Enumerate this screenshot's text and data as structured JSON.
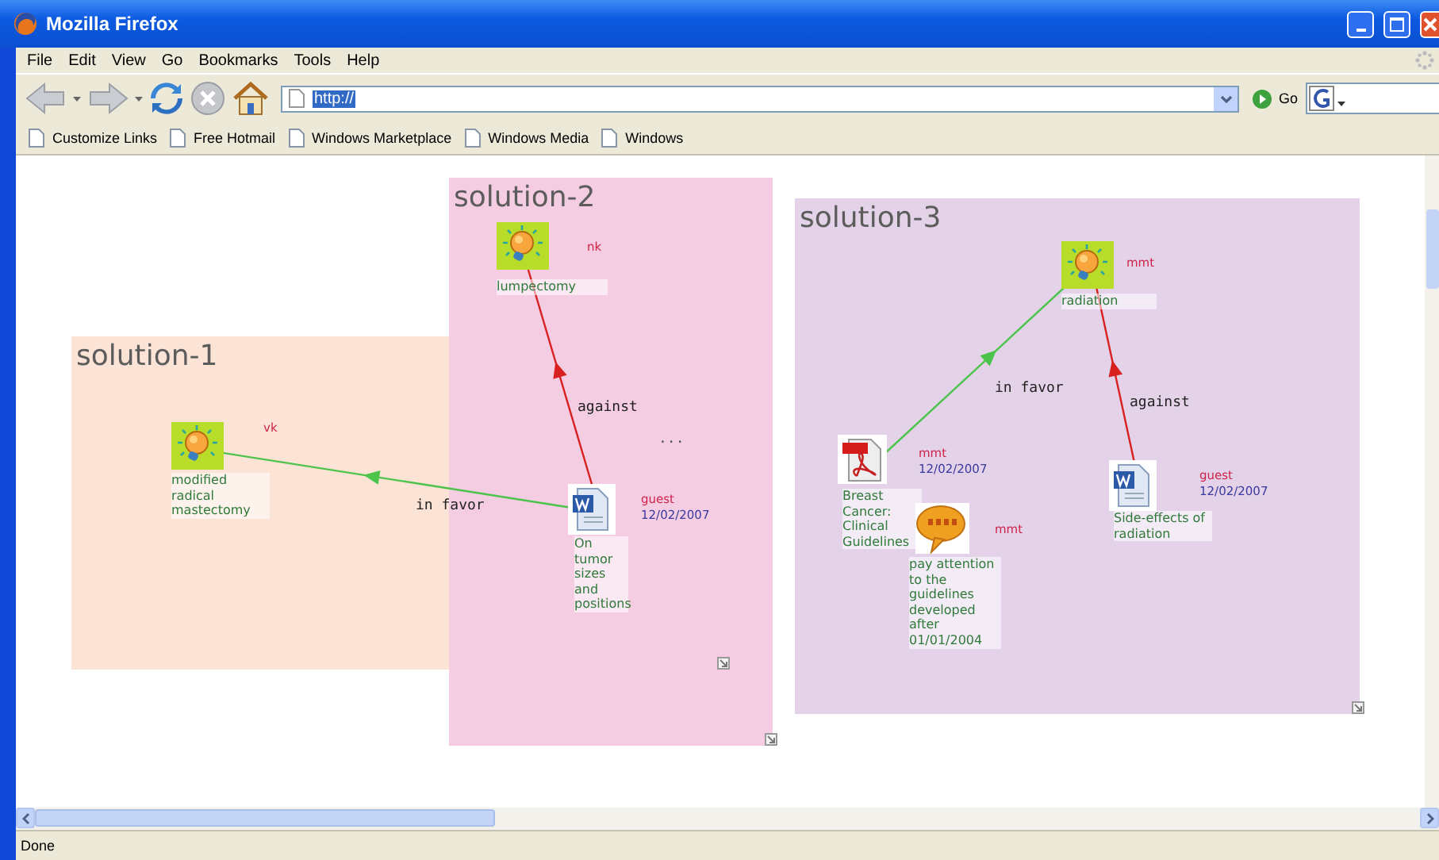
{
  "window": {
    "title": "Mozilla Firefox"
  },
  "menu": [
    "File",
    "Edit",
    "View",
    "Go",
    "Bookmarks",
    "Tools",
    "Help"
  ],
  "toolbar": {
    "address": "http://",
    "go": "Go"
  },
  "bookmarks": [
    "Customize Links",
    "Free Hotmail",
    "Windows Marketplace",
    "Windows Media",
    "Windows"
  ],
  "map": {
    "solutions": [
      {
        "title": "solution-1",
        "color": "#fbe3d6"
      },
      {
        "title": "solution-2",
        "color": "#f4cde2"
      },
      {
        "title": "solution-3",
        "color": "#e4d3e8"
      }
    ],
    "nodes": [
      {
        "kind": "idea",
        "label": "lumpectomy",
        "author": "nk"
      },
      {
        "kind": "idea",
        "label": "modified radical mastectomy",
        "author": "vk"
      },
      {
        "kind": "document",
        "label": "On tumor sizes and positions",
        "author": "guest",
        "date": "12/02/2007"
      },
      {
        "kind": "idea",
        "label": "radiation",
        "author": "mmt"
      },
      {
        "kind": "pdf",
        "label": "Breast Cancer: Clinical Guidelines",
        "author": "mmt",
        "date": "12/02/2007"
      },
      {
        "kind": "comment",
        "label": "pay attention to the guidelines developed after 01/01/2004",
        "author": "mmt"
      },
      {
        "kind": "document",
        "label": "Side-effects of radiation",
        "author": "guest",
        "date": "12/02/2007"
      }
    ],
    "links": [
      {
        "kind": "favor",
        "label": "in favor"
      },
      {
        "kind": "against",
        "label": "against"
      },
      {
        "kind": "favor",
        "label": "in favor"
      },
      {
        "kind": "against",
        "label": "against"
      }
    ],
    "ellipsis": "..."
  },
  "status_bar": {
    "text": "Done"
  }
}
